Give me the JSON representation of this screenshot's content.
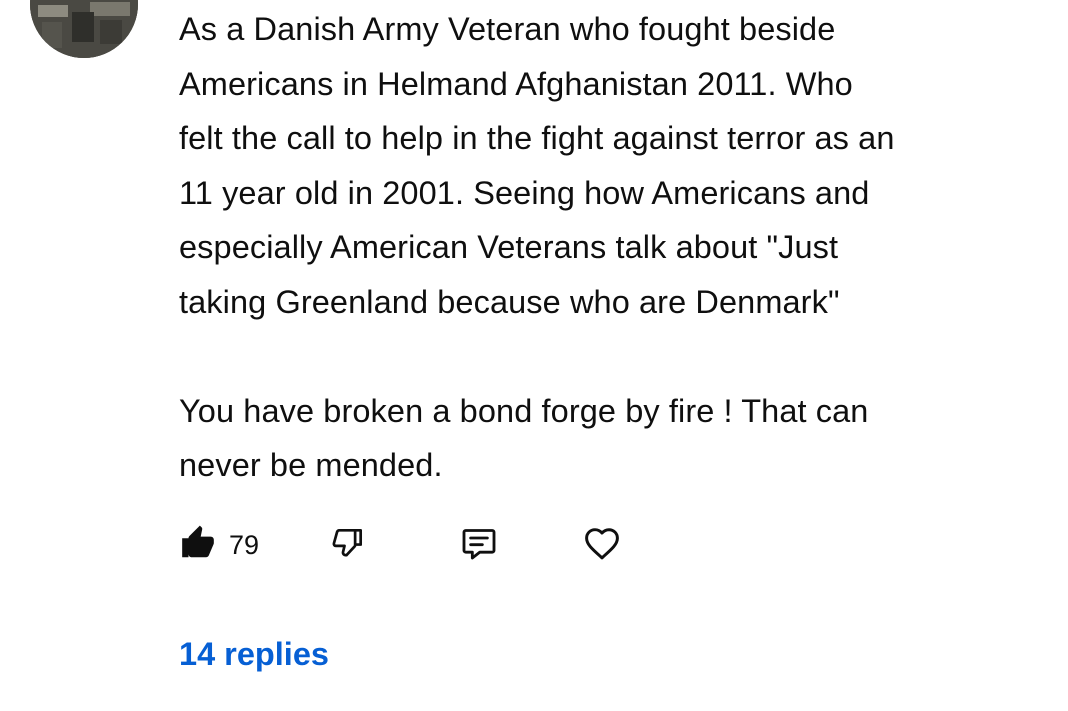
{
  "comment": {
    "text": "As a Danish Army Veteran who fought beside\nAmericans in Helmand Afghanistan 2011. Who\nfelt the call to help in the fight against terror as an\n11 year old in 2001. Seeing how Americans and\nespecially American Veterans talk about \"Just\ntaking Greenland because who are Denmark\"\n\nYou have broken a bond forge by fire ! That can\nnever be mended.",
    "like_count": "79"
  },
  "actions": {
    "like_icon": "thumbs-up-filled-icon",
    "dislike_icon": "thumbs-down-outline-icon",
    "reply_icon": "comment-reply-icon",
    "heart_icon": "heart-outline-icon"
  },
  "replies": {
    "label": "14 replies",
    "color": "#065fd4"
  }
}
